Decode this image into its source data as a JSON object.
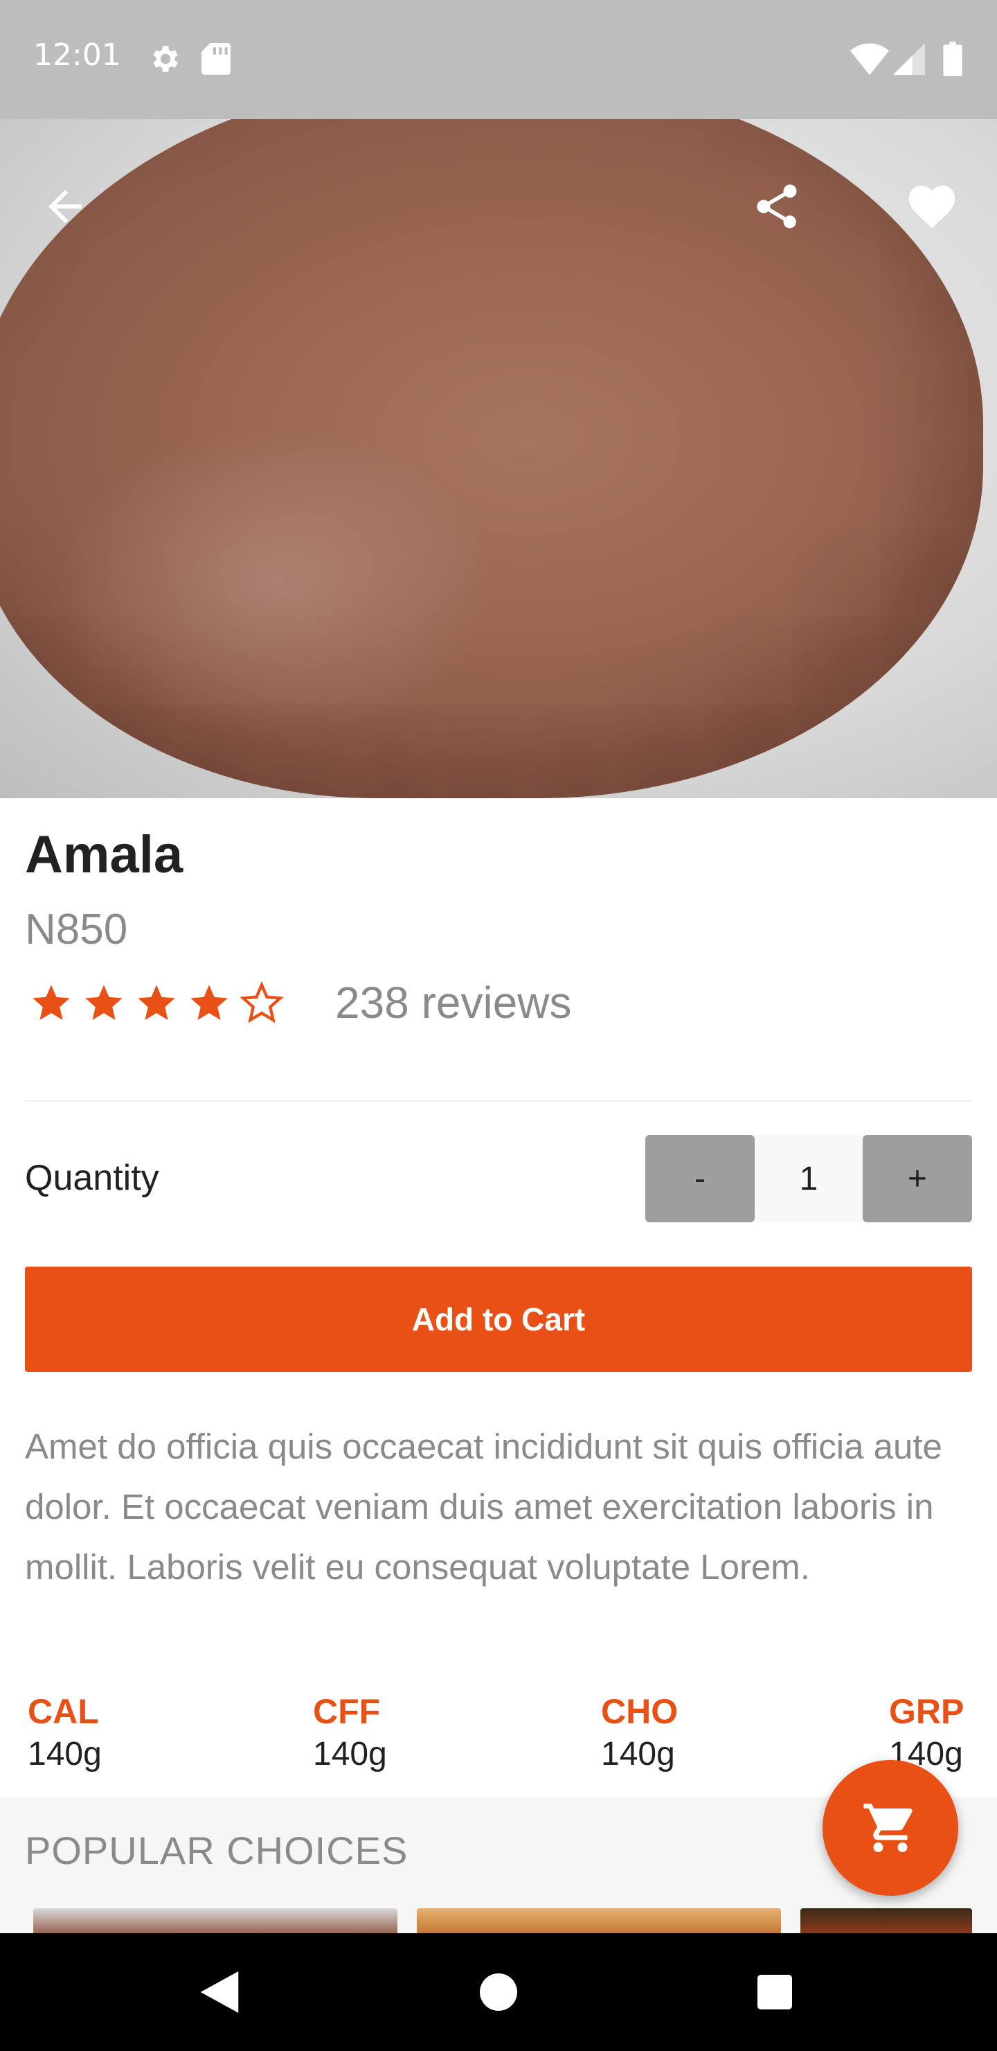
{
  "status_bar": {
    "time": "12:01",
    "icons": [
      "settings-icon",
      "sd-card-icon",
      "wifi-icon",
      "cell-signal-icon",
      "battery-icon"
    ]
  },
  "hero": {
    "icons": [
      "back-arrow-icon",
      "share-icon",
      "heart-icon"
    ]
  },
  "product": {
    "name": "Amala",
    "price": "N850",
    "rating": 4,
    "rating_max": 5,
    "reviews": "238 reviews"
  },
  "quantity": {
    "label": "Quantity",
    "minus": "-",
    "value": "1",
    "plus": "+"
  },
  "actions": {
    "add_to_cart": "Add to Cart"
  },
  "description": "Amet do officia quis occaecat incididunt sit quis officia aute dolor. Et occaecat veniam duis amet exercitation laboris in mollit. Laboris velit eu consequat voluptate Lorem.",
  "nutrients": [
    {
      "key": "CAL",
      "value": "140g"
    },
    {
      "key": "CFF",
      "value": "140g"
    },
    {
      "key": "CHO",
      "value": "140g"
    },
    {
      "key": "GRP",
      "value": "140g"
    }
  ],
  "popular": {
    "title": "POPULAR CHOICES"
  },
  "colors": {
    "accent": "#e85016",
    "status_bar": "#bdbdbd",
    "muted_text": "#8a8a8a",
    "dark_text": "#212121"
  }
}
